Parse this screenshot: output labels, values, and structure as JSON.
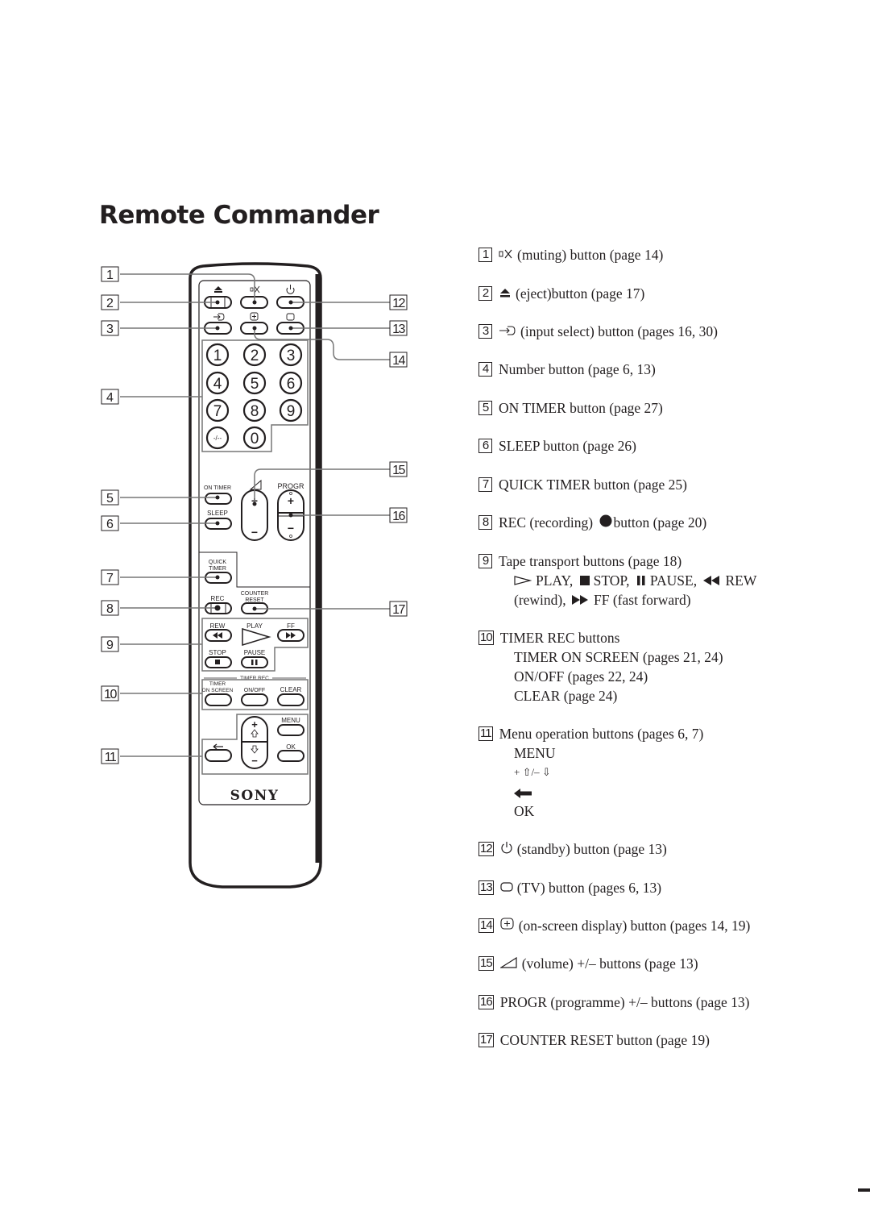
{
  "page": {
    "title": "Remote Commander"
  },
  "remote": {
    "brand": "SONY",
    "buttons": {
      "eject_icon": "eject-icon",
      "mute_icon": "mute-icon",
      "standby_icon": "standby-icon",
      "input_icon": "input-select-icon",
      "display_icon": "on-screen-display-icon",
      "tv_icon": "tv-icon",
      "numbers": [
        "1",
        "2",
        "3",
        "4",
        "5",
        "6",
        "7",
        "8",
        "9",
        "-/--",
        "0"
      ],
      "on_timer": "ON TIMER",
      "sleep": "SLEEP",
      "volume_plus": "+",
      "volume_minus": "−",
      "progr": "PROGR",
      "progr_plus": "+",
      "progr_minus": "−",
      "quick_timer_line1": "QUICK",
      "quick_timer_line2": "TIMER",
      "rec": "REC",
      "counter_reset_line1": "COUNTER",
      "counter_reset_line2": "RESET",
      "rew": "REW",
      "play": "PLAY",
      "ff": "FF",
      "stop": "STOP",
      "pause": "PAUSE",
      "timer_rec_group": "TIMER REC",
      "timer_on_screen_line1": "TIMER",
      "timer_on_screen_line2": "ON SCREEN",
      "on_off": "ON/OFF",
      "clear": "CLEAR",
      "menu": "MENU",
      "ok": "OK",
      "menu_plus": "+",
      "menu_minus": "−"
    },
    "callouts": [
      "1",
      "2",
      "3",
      "4",
      "5",
      "6",
      "7",
      "8",
      "9",
      "10",
      "11",
      "12",
      "13",
      "14",
      "15",
      "16",
      "17"
    ]
  },
  "legend": [
    {
      "num": "1",
      "icon": "mute-icon",
      "text": "(muting) button (page 14)"
    },
    {
      "num": "2",
      "icon": "eject-icon",
      "text": "(eject)button (page 17)"
    },
    {
      "num": "3",
      "icon": "input-select-icon",
      "text": "(input select) button (pages 16, 30)"
    },
    {
      "num": "4",
      "icon": "",
      "text": "Number button (page 6, 13)"
    },
    {
      "num": "5",
      "icon": "",
      "text": "ON TIMER button (page 27)"
    },
    {
      "num": "6",
      "icon": "",
      "text": "SLEEP button (page 26)"
    },
    {
      "num": "7",
      "icon": "",
      "text": "QUICK TIMER button (page 25)"
    },
    {
      "num": "8",
      "icon": "",
      "text": "REC (recording)",
      "text_after_icon": "button (page 20)"
    },
    {
      "num": "9",
      "icon": "",
      "text": "Tape transport buttons (page 18)",
      "sub": [
        {
          "play": "PLAY,",
          "stop": "STOP,",
          "pause": "PAUSE,",
          "rew": "REW"
        },
        {
          "rewind": "(rewind),",
          "ff": "FF (fast forward)"
        }
      ]
    },
    {
      "num": "10",
      "icon": "",
      "text": "TIMER REC buttons",
      "sub": [
        "TIMER ON SCREEN (pages 21, 24)",
        "ON/OFF (pages 22, 24)",
        "CLEAR (page 24)"
      ]
    },
    {
      "num": "11",
      "icon": "",
      "text": "Menu operation buttons (pages 6, 7)",
      "sub": [
        "MENU",
        "+ ⇧/– ⇩",
        "back-arrow-icon",
        "OK"
      ]
    },
    {
      "num": "12",
      "icon": "standby-icon",
      "text": "(standby) button (page 13)"
    },
    {
      "num": "13",
      "icon": "tv-icon",
      "text": "(TV) button (pages 6, 13)"
    },
    {
      "num": "14",
      "icon": "on-screen-display-icon",
      "text": "(on-screen display) button (pages 14, 19)"
    },
    {
      "num": "15",
      "icon": "volume-icon",
      "text": "(volume) +/– buttons (page 13)"
    },
    {
      "num": "16",
      "icon": "",
      "text": "PROGR (programme) +/– buttons (page 13)"
    },
    {
      "num": "17",
      "icon": "",
      "text": "COUNTER RESET button (page 19)"
    }
  ]
}
